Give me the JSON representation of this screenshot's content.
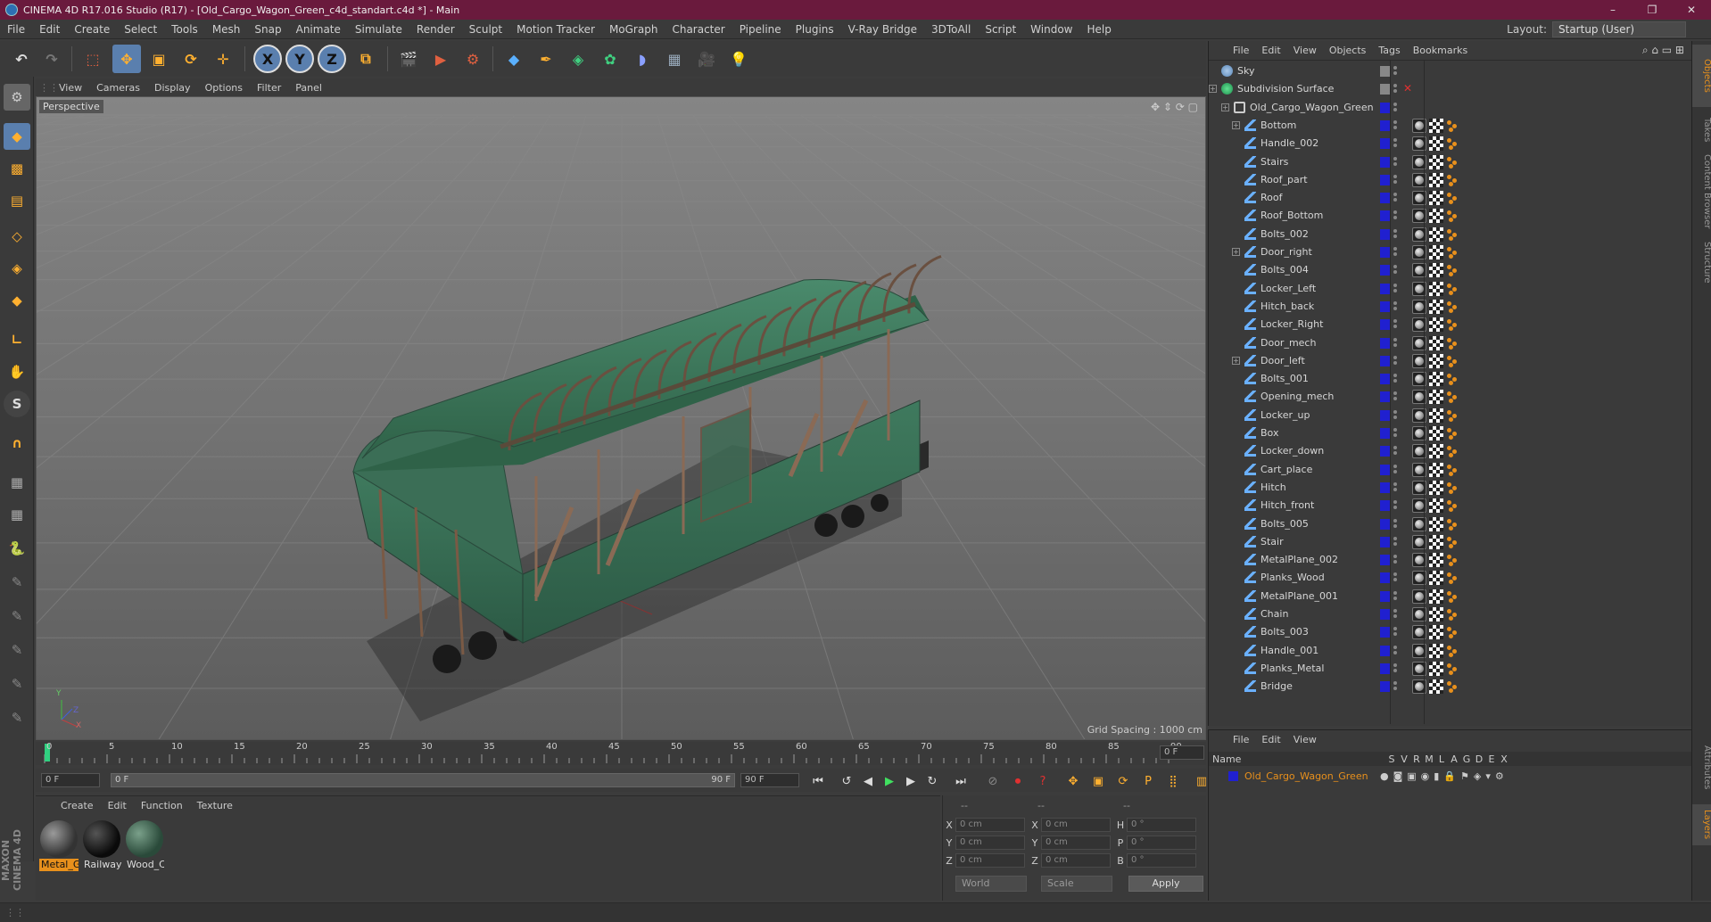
{
  "window": {
    "title": "CINEMA 4D R17.016 Studio (R17) - [Old_Cargo_Wagon_Green_c4d_standart.c4d *] - Main",
    "minimize": "–",
    "restore": "❐",
    "close": "✕"
  },
  "menubar": [
    "File",
    "Edit",
    "Create",
    "Select",
    "Tools",
    "Mesh",
    "Snap",
    "Animate",
    "Simulate",
    "Render",
    "Sculpt",
    "Motion Tracker",
    "MoGraph",
    "Character",
    "Pipeline",
    "Plugins",
    "V-Ray Bridge",
    "3DToAll",
    "Script",
    "Window",
    "Help"
  ],
  "layout": {
    "label": "Layout:",
    "value": "Startup (User)"
  },
  "toolbar": {
    "x": "X",
    "y": "Y",
    "z": "Z"
  },
  "viewport": {
    "menu": [
      "View",
      "Cameras",
      "Display",
      "Options",
      "Filter",
      "Panel"
    ],
    "label": "Perspective",
    "grid_spacing": "Grid Spacing : 1000 cm",
    "axis_y": "Y",
    "axis_z": "Z",
    "axis_x": "X"
  },
  "timeline": {
    "ticks": [
      "0",
      "5",
      "10",
      "15",
      "20",
      "25",
      "30",
      "35",
      "40",
      "45",
      "50",
      "55",
      "60",
      "65",
      "70",
      "75",
      "80",
      "85",
      "90"
    ],
    "end_frame": "0 F",
    "start_field": "0 F",
    "slider_left": "0 F",
    "slider_right": "90 F",
    "max_field": "90 F"
  },
  "materials": {
    "menu": [
      "Create",
      "Edit",
      "Function",
      "Texture"
    ],
    "items": [
      {
        "label": "Metal_G",
        "selected": true
      },
      {
        "label": "Railway",
        "selected": false
      },
      {
        "label": "Wood_C",
        "selected": false
      }
    ]
  },
  "coords": {
    "headers": [
      "--",
      "--",
      "--"
    ],
    "rows": [
      {
        "l1": "X",
        "v1": "0 cm",
        "l2": "X",
        "v2": "0 cm",
        "l3": "H",
        "v3": "0 °"
      },
      {
        "l1": "Y",
        "v1": "0 cm",
        "l2": "Y",
        "v2": "0 cm",
        "l3": "P",
        "v3": "0 °"
      },
      {
        "l1": "Z",
        "v1": "0 cm",
        "l2": "Z",
        "v2": "0 cm",
        "l3": "B",
        "v3": "0 °"
      }
    ],
    "mode": "World",
    "scale": "Scale",
    "apply": "Apply"
  },
  "objects": {
    "menu": [
      "File",
      "Edit",
      "View",
      "Objects",
      "Tags",
      "Bookmarks"
    ],
    "top": [
      {
        "name": "Sky"
      },
      {
        "name": "Subdivision Surface"
      },
      {
        "name": "Old_Cargo_Wagon_Green"
      }
    ],
    "children": [
      "Bottom",
      "Handle_002",
      "Stairs",
      "Roof_part",
      "Roof",
      "Roof_Bottom",
      "Bolts_002",
      "Door_right",
      "Bolts_004",
      "Locker_Left",
      "Hitch_back",
      "Locker_Right",
      "Door_mech",
      "Door_left",
      "Bolts_001",
      "Opening_mech",
      "Locker_up",
      "Box",
      "Locker_down",
      "Cart_place",
      "Hitch",
      "Hitch_front",
      "Bolts_005",
      "Stair",
      "MetalPlane_002",
      "Planks_Wood",
      "MetalPlane_001",
      "Chain",
      "Bolts_003",
      "Handle_001",
      "Planks_Metal",
      "Bridge"
    ],
    "expandable": [
      "Bottom",
      "Door_right",
      "Door_left"
    ]
  },
  "attributes": {
    "menu": [
      "File",
      "Edit",
      "View"
    ],
    "columns": [
      "Name",
      "S",
      "V",
      "R",
      "M",
      "L",
      "A",
      "G",
      "D",
      "E",
      "X"
    ],
    "layer_name": "Old_Cargo_Wagon_Green"
  },
  "sidetabs": [
    "Objects",
    "Takes",
    "Content Browser",
    "Structure",
    "Attributes",
    "Layers"
  ],
  "branding": "MAXON CINEMA 4D",
  "colors": {
    "accent": "#e8901c",
    "title_bar": "#6a1a3d",
    "layer_blue": "#2020d0"
  }
}
